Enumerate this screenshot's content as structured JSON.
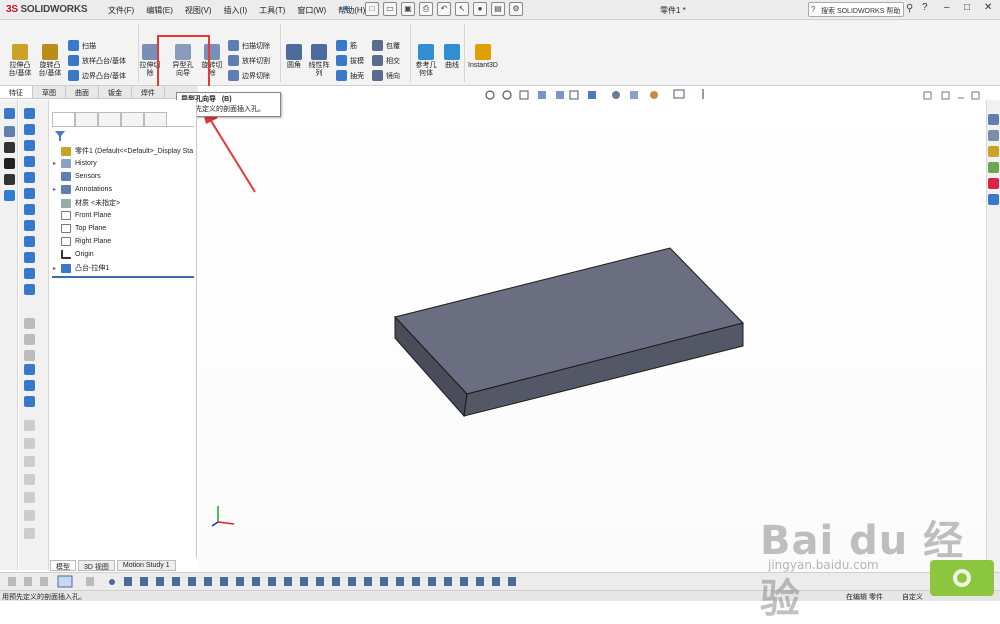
{
  "app": {
    "logo_prefix": "3S",
    "logo_name": "SOLIDWORKS"
  },
  "menu": [
    "文件(F)",
    "编辑(E)",
    "视图(V)",
    "插入(I)",
    "工具(T)",
    "窗口(W)",
    "帮助(H)"
  ],
  "document_title": "零件1 *",
  "search": {
    "placeholder": "搜索 SOLIDWORKS 帮助"
  },
  "ribbon": {
    "extrude_boss": "拉伸凸\n台/基体",
    "revolve_boss": "旋转凸\n台/基体",
    "sweep": "扫描",
    "loft_boss": "放样凸台/基体",
    "boundary_boss": "边界凸台/基体",
    "extrude_cut": "拉伸切\n除",
    "hole_wizard": "异型孔\n向导",
    "revolve_cut": "旋转切\n除",
    "sweep_cut": "扫描切除",
    "loft_cut": "放样切割",
    "boundary_cut": "边界切除",
    "fillet": "圆角",
    "linear_pattern": "线性阵\n列",
    "rib": "筋",
    "draft": "拔模",
    "shell": "抽壳",
    "wrap": "包覆",
    "intersect": "相交",
    "mirror": "镜向",
    "reference_geometry": "参考几\n何体",
    "curves": "曲线",
    "instant3d": "Instant3D"
  },
  "command_tabs": [
    "特征",
    "草图",
    "曲面",
    "钣金",
    "焊件"
  ],
  "tooltip": {
    "title": "异型孔向导",
    "shortcut": "(B)",
    "description": "用预先定义的剖面插入孔。"
  },
  "tree": {
    "root": "零件1 (Default<<Default>_Display Sta",
    "items": [
      "History",
      "Sensors",
      "Annotations",
      "材质 <未指定>",
      "Front Plane",
      "Top Plane",
      "Right Plane",
      "Origin",
      "凸台-拉伸1"
    ]
  },
  "bottom_tabs": [
    "模型",
    "3D 视图",
    "Motion Study 1"
  ],
  "status": {
    "left": "用预先定义的剖面插入孔。",
    "editing": "在编辑 零件",
    "custom": "自定义"
  },
  "watermark": {
    "main": "Bai du 经验",
    "url": "jingyan.baidu.com"
  },
  "colors": {
    "highlight": "#e53935",
    "model_top": "#6b6e80",
    "model_side": "#4a4c5a",
    "accent": "#1a6fc2"
  }
}
